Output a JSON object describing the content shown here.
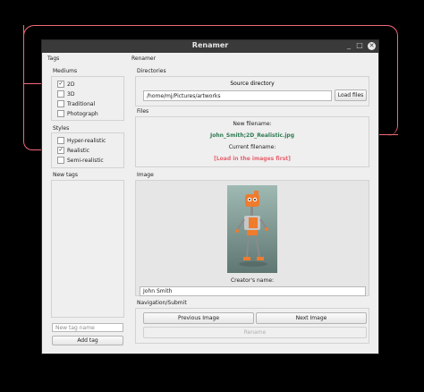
{
  "window": {
    "title": "Renamer",
    "controls": {
      "minimize": "_",
      "maximize": "□",
      "close": "✕"
    }
  },
  "left_panel": {
    "tags_label": "Tags",
    "mediums": {
      "label": "Mediums",
      "items": [
        {
          "label": "2D",
          "checked": true
        },
        {
          "label": "3D",
          "checked": false
        },
        {
          "label": "Traditional",
          "checked": false
        },
        {
          "label": "Photograph",
          "checked": false
        }
      ]
    },
    "styles": {
      "label": "Styles",
      "items": [
        {
          "label": "Hyper-realistic",
          "checked": false
        },
        {
          "label": "Realistic",
          "checked": true
        },
        {
          "label": "Semi-realistic",
          "checked": false
        }
      ]
    },
    "new_tags_label": "New tags",
    "new_tag_input": {
      "placeholder": "New tag name",
      "value": ""
    },
    "add_tag_button": "Add tag"
  },
  "right_panel": {
    "renamer_label": "Renamer",
    "directories": {
      "label": "Directories",
      "source_label": "Source directory",
      "source_value": "/home/mj/Pictures/artworks",
      "load_button": "Load files"
    },
    "files": {
      "label": "Files",
      "new_filename_label": "New filename:",
      "new_filename_value": "John_Smith;2D_Realistic.jpg",
      "current_filename_label": "Current filename:",
      "current_filename_value": "[Load in the images first]"
    },
    "image": {
      "label": "Image",
      "creator_label": "Creator's name:",
      "creator_value": "John Smith"
    },
    "navigation": {
      "label": "Navigation/Submit",
      "previous_button": "Previous Image",
      "next_button": "Next Image",
      "rename_button": "Rename"
    }
  },
  "colors": {
    "annotation": "#f06a78",
    "new_filename_text": "#2f7a52",
    "current_filename_text": "#e8626e"
  }
}
